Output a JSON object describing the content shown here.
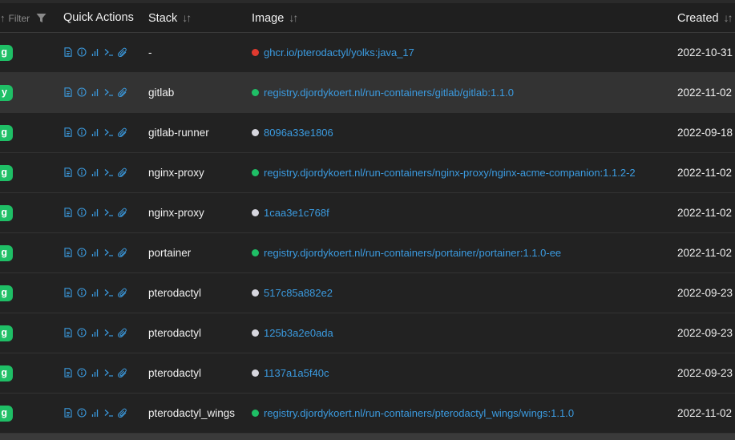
{
  "header": {
    "filter_label": "Filter",
    "quick_actions": "Quick Actions",
    "stack": "Stack",
    "image": "Image",
    "created": "Created",
    "sort_glyph": "↓↑"
  },
  "colors": {
    "status_running": "#1fbf66",
    "dot_red": "#e03a2f",
    "dot_green": "#1fbf66",
    "dot_gray": "#d6d6de",
    "link": "#3b9be0"
  },
  "quick_action_icons": [
    "logs-icon",
    "inspect-icon",
    "stats-icon",
    "console-icon",
    "attach-icon"
  ],
  "rows": [
    {
      "badge": "g",
      "stack": "-",
      "image": "ghcr.io/pterodactyl/yolks:java_17",
      "dot": "red",
      "created": "2022-10-31"
    },
    {
      "badge": "y",
      "stack": "gitlab",
      "image": "registry.djordykoert.nl/run-containers/gitlab/gitlab:1.1.0",
      "dot": "green",
      "created": "2022-11-02"
    },
    {
      "badge": "g",
      "stack": "gitlab-runner",
      "image": "8096a33e1806",
      "dot": "gray",
      "created": "2022-09-18"
    },
    {
      "badge": "g",
      "stack": "nginx-proxy",
      "image": "registry.djordykoert.nl/run-containers/nginx-proxy/nginx-acme-companion:1.1.2-2",
      "dot": "green",
      "created": "2022-11-02"
    },
    {
      "badge": "g",
      "stack": "nginx-proxy",
      "image": "1caa3e1c768f",
      "dot": "gray",
      "created": "2022-11-02"
    },
    {
      "badge": "g",
      "stack": "portainer",
      "image": "registry.djordykoert.nl/run-containers/portainer/portainer:1.1.0-ee",
      "dot": "green",
      "created": "2022-11-02"
    },
    {
      "badge": "g",
      "stack": "pterodactyl",
      "image": "517c85a882e2",
      "dot": "gray",
      "created": "2022-09-23"
    },
    {
      "badge": "g",
      "stack": "pterodactyl",
      "image": "125b3a2e0ada",
      "dot": "gray",
      "created": "2022-09-23"
    },
    {
      "badge": "g",
      "stack": "pterodactyl",
      "image": "1137a1a5f40c",
      "dot": "gray",
      "created": "2022-09-23"
    },
    {
      "badge": "g",
      "stack": "pterodactyl_wings",
      "image": "registry.djordykoert.nl/run-containers/pterodactyl_wings/wings:1.1.0",
      "dot": "green",
      "created": "2022-11-02"
    }
  ]
}
